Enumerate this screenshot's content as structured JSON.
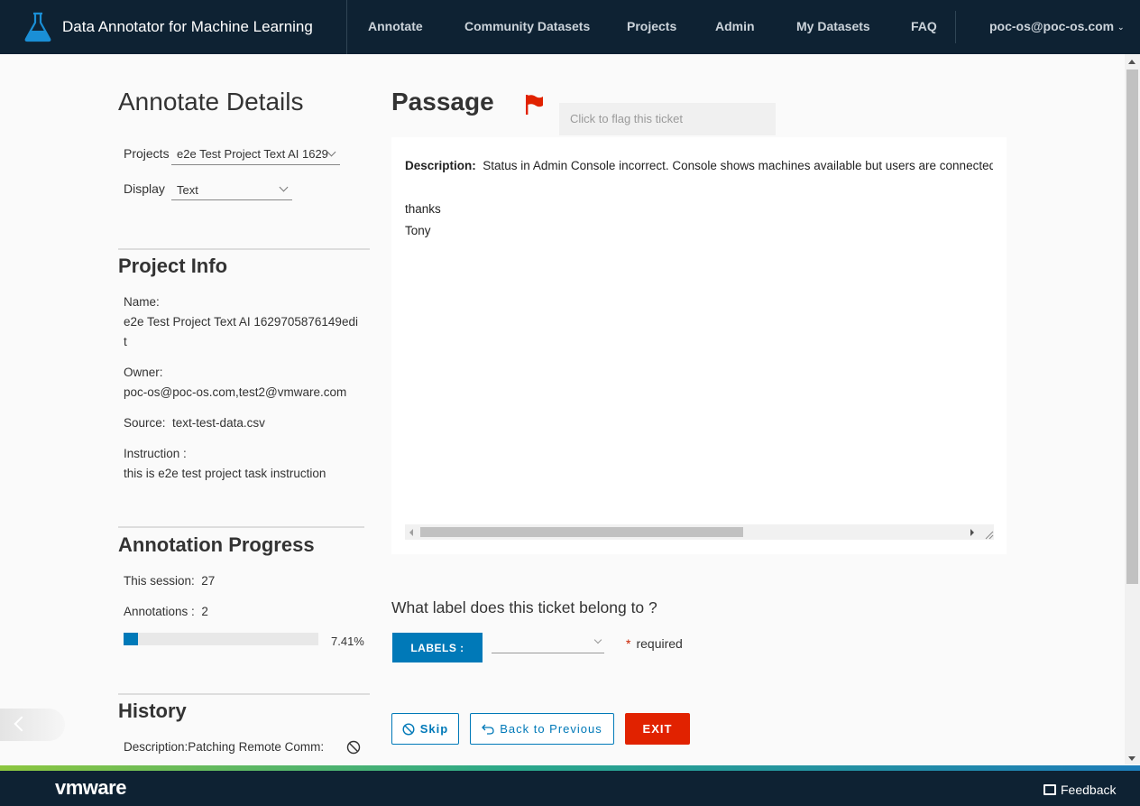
{
  "header": {
    "app_title": "Data Annotator for Machine Learning",
    "nav": [
      "Annotate",
      "Community Datasets",
      "Projects",
      "Admin",
      "My Datasets",
      "FAQ"
    ],
    "user": "poc-os@poc-os.com"
  },
  "left": {
    "title": "Annotate Details",
    "projects_label": "Projects",
    "projects_value": "e2e Test Project Text AI 1629",
    "display_label": "Display",
    "display_value": "Text",
    "project_info_title": "Project Info",
    "name_label": "Name:",
    "name_value_line1": "e2e Test Project Text AI 1629705876149edi",
    "name_value_line2": "t",
    "owner_label": "Owner:",
    "owner_value": "poc-os@poc-os.com,test2@vmware.com",
    "source_label": "Source:",
    "source_value": "text-test-data.csv",
    "instruction_label": "Instruction :",
    "instruction_value": "this is e2e test project task instruction",
    "progress_title": "Annotation Progress",
    "session_label": "This session:",
    "session_value": "27",
    "annotations_label": "Annotations :",
    "annotations_value": "2",
    "progress_percent": "7.41%",
    "progress_fraction": 0.0741,
    "history_title": "History",
    "history_item": "Description:Patching Remote Comm:"
  },
  "passage": {
    "title": "Passage",
    "flag_tooltip": "Click to flag this ticket",
    "description_key": "Description",
    "description_text": "Status in Admin Console incorrect. Console shows machines available but users are connected",
    "line2": "thanks",
    "line3": "Tony"
  },
  "labeling": {
    "question": "What label does this ticket belong to ?",
    "labels_button": "LABELS :",
    "required_star": "*",
    "required_text": "required"
  },
  "actions": {
    "skip": "Skip",
    "back": "Back to Previous",
    "exit": "EXIT"
  },
  "footer": {
    "brand": "vmware",
    "feedback": "Feedback"
  },
  "colors": {
    "header_bg": "#0e2233",
    "primary": "#0079b8",
    "danger": "#e12200",
    "flag": "#e12200"
  }
}
